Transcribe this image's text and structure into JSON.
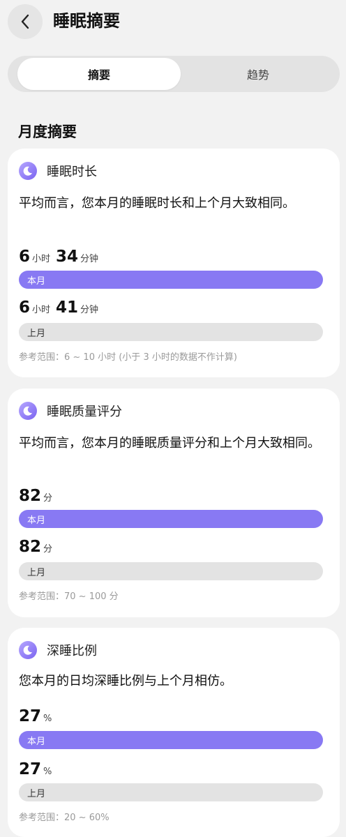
{
  "header": {
    "title": "睡眠摘要"
  },
  "tabs": [
    {
      "label": "摘要",
      "active": true
    },
    {
      "label": "趋势",
      "active": false
    }
  ],
  "section_title": "月度摘要",
  "cards": [
    {
      "icon": "moon-icon",
      "name": "睡眠时长",
      "description": "平均而言，您本月的睡眠时长和上个月大致相同。",
      "current": {
        "v1": "6",
        "u1": "小时",
        "v2": "34",
        "u2": "分钟",
        "bar_label": "本月",
        "fraction": 1.0
      },
      "previous": {
        "v1": "6",
        "u1": "小时",
        "v2": "41",
        "u2": "分钟",
        "bar_label": "上月",
        "fraction": 1.0
      },
      "reference": "参考范围：6 ~ 10 小时 (小于 3 小时的数据不作计算)"
    },
    {
      "icon": "moon-icon",
      "name": "睡眠质量评分",
      "description": "平均而言，您本月的睡眠质量评分和上个月大致相同。",
      "current": {
        "v1": "82",
        "u1": "分",
        "bar_label": "本月",
        "fraction": 1.0
      },
      "previous": {
        "v1": "82",
        "u1": "分",
        "bar_label": "上月",
        "fraction": 1.0
      },
      "reference": "参考范围：70 ~ 100 分"
    },
    {
      "icon": "moon-icon",
      "name": "深睡比例",
      "description": "您本月的日均深睡比例与上个月相仿。",
      "current": {
        "v1": "27",
        "u1": "%",
        "bar_label": "本月",
        "fraction": 1.0
      },
      "previous": {
        "v1": "27",
        "u1": "%",
        "bar_label": "上月",
        "fraction": 1.0
      },
      "reference": "参考范围：20 ~ 60%"
    }
  ],
  "colors": {
    "current_bar": "#8879f3",
    "previous_bar": "#e3e3e3",
    "background": "#f2f2f2"
  }
}
